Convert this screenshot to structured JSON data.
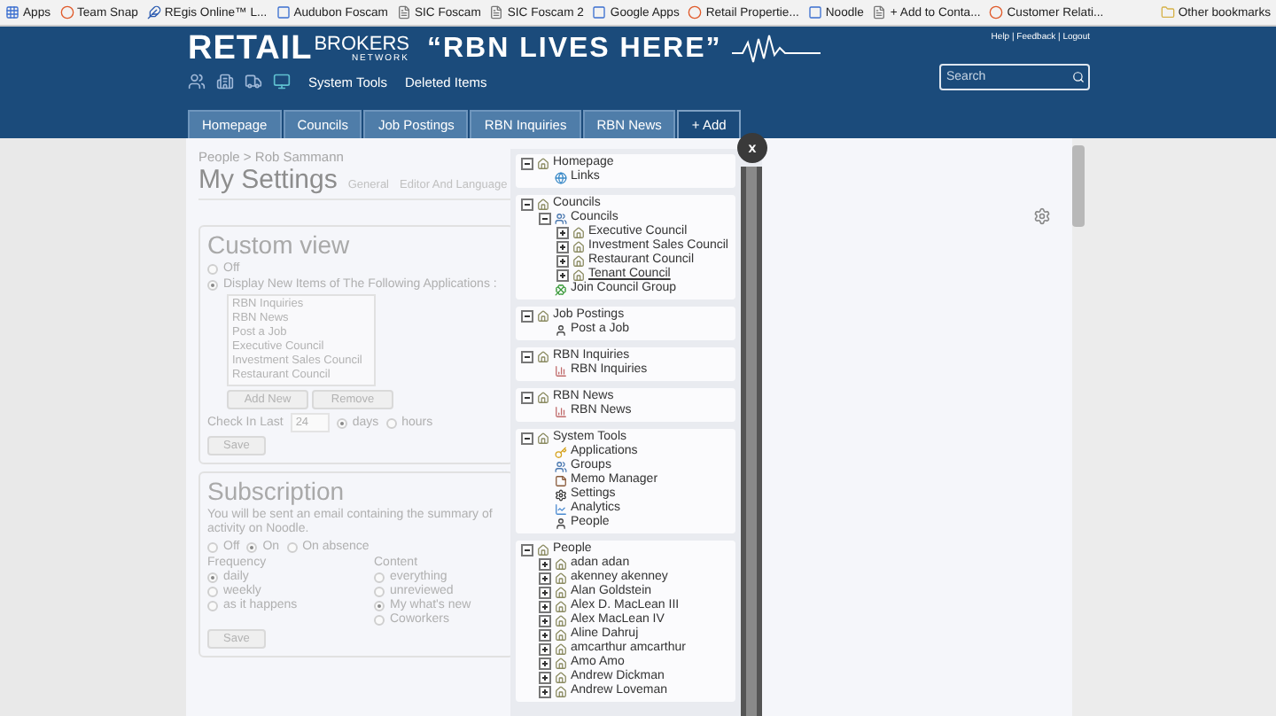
{
  "bookmarks": [
    {
      "label": "Apps"
    },
    {
      "label": "Team Snap"
    },
    {
      "label": "REgis Online™ L..."
    },
    {
      "label": "Audubon Foscam"
    },
    {
      "label": "SIC Foscam"
    },
    {
      "label": "SIC Foscam 2"
    },
    {
      "label": "Google Apps"
    },
    {
      "label": "Retail Propertie..."
    },
    {
      "label": "Noodle"
    },
    {
      "label": "+ Add to Conta..."
    },
    {
      "label": "Customer Relati..."
    }
  ],
  "other_bookmarks": "Other bookmarks",
  "header": {
    "logo": {
      "bold": "RETAIL",
      "light": "BROKERS",
      "small": "NETWORK"
    },
    "tagline": "“RBN LIVES HERE”",
    "toolbar_links": [
      "System Tools",
      "Deleted Items"
    ],
    "top_links": "Help | Feedback | Logout",
    "search": {
      "placeholder": "Search"
    }
  },
  "nav": [
    {
      "label": "Homepage",
      "kind": "tab"
    },
    {
      "label": "Councils",
      "kind": "tab"
    },
    {
      "label": "Job Postings",
      "kind": "tab"
    },
    {
      "label": "RBN Inquiries",
      "kind": "tab"
    },
    {
      "label": "RBN News",
      "kind": "tab"
    },
    {
      "label": "+ Add",
      "kind": "add"
    }
  ],
  "settings": {
    "breadcrumb": "People > Rob Sammann",
    "title": "My Settings",
    "tabs": [
      "General",
      "Editor And Language"
    ],
    "custom_view": {
      "title": "Custom view",
      "options": [
        {
          "label": "Off",
          "selected": false
        },
        {
          "label": "Display New Items of The Following Applications :",
          "selected": true
        }
      ],
      "list": [
        "RBN Inquiries",
        "RBN News",
        "Post a Job",
        "Executive Council",
        "Investment Sales Council",
        "Restaurant Council"
      ],
      "buttons": [
        "Add New",
        "Remove"
      ],
      "check_in": {
        "label": "Check In Last",
        "value": "24",
        "units": [
          {
            "label": "days",
            "selected": true
          },
          {
            "label": "hours",
            "selected": false
          }
        ]
      },
      "save": "Save"
    },
    "subscription": {
      "title": "Subscription",
      "description": "You will be sent an email containing the summary of activity on Noodle.",
      "modes": [
        {
          "label": "Off",
          "selected": false
        },
        {
          "label": "On",
          "selected": true
        },
        {
          "label": "On absence",
          "selected": false
        }
      ],
      "frequency": {
        "label": "Frequency",
        "options": [
          {
            "label": "daily",
            "selected": true
          },
          {
            "label": "weekly",
            "selected": false
          },
          {
            "label": "as it happens",
            "selected": false
          }
        ]
      },
      "content": {
        "label": "Content",
        "options": [
          {
            "label": "everything",
            "selected": false
          },
          {
            "label": "unreviewed",
            "selected": false
          },
          {
            "label": "My what's new",
            "selected": true
          },
          {
            "label": "Coworkers",
            "selected": false
          }
        ]
      },
      "save": "Save"
    }
  },
  "tree": {
    "close_label": "x",
    "sections": [
      {
        "label": "Homepage",
        "kind": "house",
        "expanded": true,
        "children": [
          {
            "label": "Links",
            "kind": "globe"
          }
        ]
      },
      {
        "label": "Councils",
        "kind": "house",
        "expanded": true,
        "children": [
          {
            "label": "Councils",
            "kind": "group",
            "expanded": true,
            "children": [
              {
                "label": "Executive Council",
                "kind": "house",
                "expanded": false
              },
              {
                "label": "Investment Sales Council",
                "kind": "house",
                "expanded": false
              },
              {
                "label": "Restaurant Council",
                "kind": "house",
                "expanded": false
              },
              {
                "label": "Tenant Council",
                "kind": "house",
                "expanded": false,
                "hovered": true
              }
            ]
          },
          {
            "label": "Join Council Group",
            "kind": "clover"
          }
        ]
      },
      {
        "label": "Job Postings",
        "kind": "house",
        "expanded": true,
        "children": [
          {
            "label": "Post a Job",
            "kind": "person"
          }
        ]
      },
      {
        "label": "RBN Inquiries",
        "kind": "house",
        "expanded": true,
        "children": [
          {
            "label": "RBN Inquiries",
            "kind": "chart"
          }
        ]
      },
      {
        "label": "RBN News",
        "kind": "house",
        "expanded": true,
        "children": [
          {
            "label": "RBN News",
            "kind": "chart"
          }
        ]
      },
      {
        "label": "System Tools",
        "kind": "house",
        "expanded": true,
        "children": [
          {
            "label": "Applications",
            "kind": "key"
          },
          {
            "label": "Groups",
            "kind": "group"
          },
          {
            "label": "Memo Manager",
            "kind": "memo"
          },
          {
            "label": "Settings",
            "kind": "gear"
          },
          {
            "label": "Analytics",
            "kind": "analytics"
          },
          {
            "label": "People",
            "kind": "person"
          }
        ]
      },
      {
        "label": "People",
        "kind": "house",
        "expanded": true,
        "children": [
          {
            "label": "adan adan",
            "kind": "house",
            "expanded": false
          },
          {
            "label": "akenney akenney",
            "kind": "house",
            "expanded": false
          },
          {
            "label": "Alan Goldstein",
            "kind": "house",
            "expanded": false
          },
          {
            "label": "Alex D. MacLean III",
            "kind": "house",
            "expanded": false
          },
          {
            "label": "Alex MacLean IV",
            "kind": "house",
            "expanded": false
          },
          {
            "label": "Aline Dahruj",
            "kind": "house",
            "expanded": false
          },
          {
            "label": "amcarthur amcarthur",
            "kind": "house",
            "expanded": false
          },
          {
            "label": "Amo Amo",
            "kind": "house",
            "expanded": false
          },
          {
            "label": "Andrew Dickman",
            "kind": "house",
            "expanded": false
          },
          {
            "label": "Andrew Loveman",
            "kind": "house",
            "expanded": false
          }
        ]
      }
    ]
  }
}
